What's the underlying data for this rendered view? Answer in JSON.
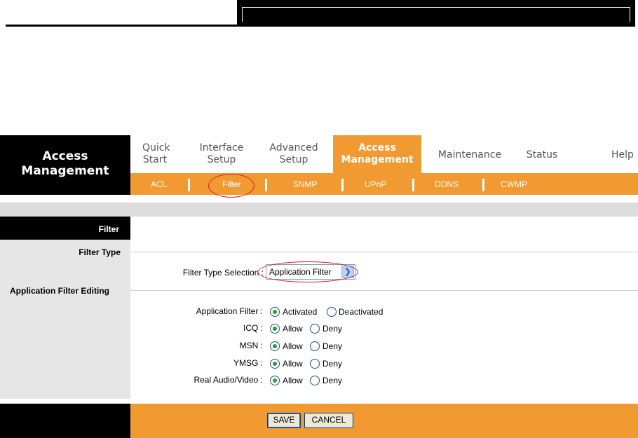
{
  "logo": {
    "line1": "Access",
    "line2": "Management"
  },
  "topnav": [
    {
      "line1": "Quick",
      "line2": "Start"
    },
    {
      "line1": "Interface",
      "line2": "Setup"
    },
    {
      "line1": "Advanced",
      "line2": "Setup"
    },
    {
      "line1": "Access",
      "line2": "Management",
      "active": true
    },
    {
      "line1": "Maintenance",
      "line2": ""
    },
    {
      "line1": "Status",
      "line2": ""
    },
    {
      "line1": "Help",
      "line2": ""
    }
  ],
  "subnav": [
    "ACL",
    "Filter",
    "SNMP",
    "UPnP",
    "DDNS",
    "CWMP"
  ],
  "section": {
    "filter": "Filter",
    "filter_type": "Filter Type",
    "app_filter_editing": "Application Filter Editing"
  },
  "filter_type_selection": {
    "label": "Filter Type Selection :",
    "value": "Application Filter"
  },
  "app_rows": [
    {
      "label": "Application Filter :",
      "opt1": "Activated",
      "opt2": "Deactivated",
      "selected": 1
    },
    {
      "label": "ICQ :",
      "opt1": "Allow",
      "opt2": "Deny",
      "selected": 1
    },
    {
      "label": "MSN :",
      "opt1": "Allow",
      "opt2": "Deny",
      "selected": 1
    },
    {
      "label": "YMSG :",
      "opt1": "Allow",
      "opt2": "Deny",
      "selected": 1
    },
    {
      "label": "Real Audio/Video :",
      "opt1": "Allow",
      "opt2": "Deny",
      "selected": 1
    }
  ],
  "buttons": {
    "save": "SAVE",
    "cancel": "CANCEL"
  },
  "colors": {
    "accent": "#f29a32",
    "highlight_circle": "#d42020"
  }
}
